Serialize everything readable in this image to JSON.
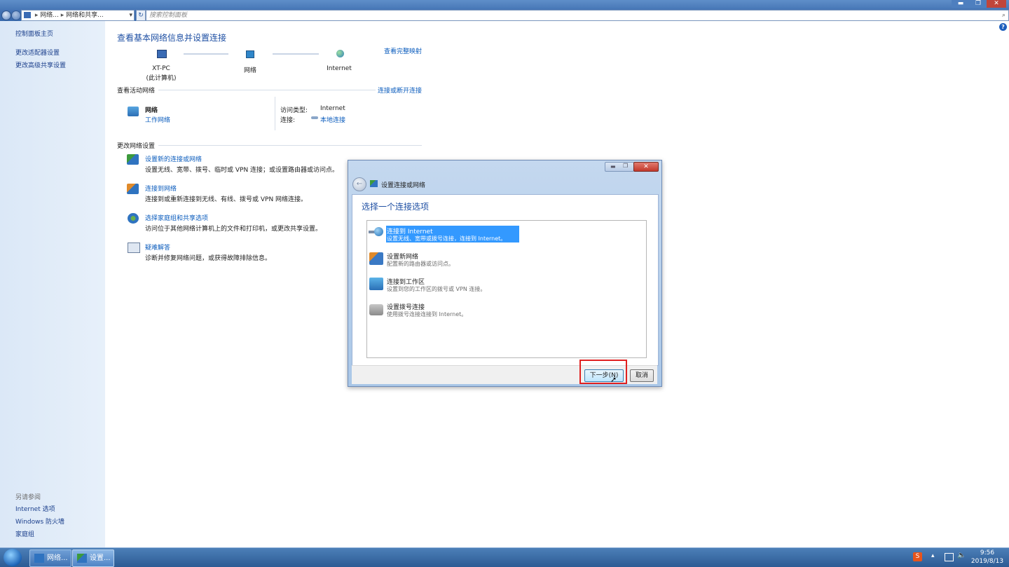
{
  "explorer": {
    "breadcrumb": [
      "网络...",
      "网络和共享..."
    ],
    "search_placeholder": "搜索控制面板",
    "window_buttons": [
      "▬",
      "❐",
      "✕"
    ],
    "help": "?"
  },
  "leftnav": {
    "home": "控制面板主页",
    "items": [
      "更改适配器设置",
      "更改高级共享设置"
    ],
    "see_also_label": "另请参阅",
    "see_also": [
      "Internet 选项",
      "Windows 防火墙",
      "家庭组"
    ]
  },
  "main": {
    "title": "查看基本网络信息并设置连接",
    "full_map_link": "查看完整映射",
    "nodes": [
      {
        "label": "XT-PC",
        "sub": "(此计算机)"
      },
      {
        "label": "网络",
        "sub": ""
      },
      {
        "label": "Internet",
        "sub": ""
      }
    ],
    "active_label": "查看活动网络",
    "connect_disconnect": "连接或断开连接",
    "network_name": "网络",
    "network_type": "工作网络",
    "access_type_label": "访问类型:",
    "access_type_value": "Internet",
    "connection_label": "连接:",
    "connection_value": "本地连接",
    "change_label": "更改网络设置",
    "tasks": [
      {
        "title": "设置新的连接或网络",
        "desc": "设置无线、宽带、拨号、临时或 VPN 连接；或设置路由器或访问点。",
        "icon": "network-setup-icon"
      },
      {
        "title": "连接到网络",
        "desc": "连接到或重新连接到无线、有线、拨号或 VPN 网络连接。",
        "icon": "connect-network-icon"
      },
      {
        "title": "选择家庭组和共享选项",
        "desc": "访问位于其他网络计算机上的文件和打印机，或更改共享设置。",
        "icon": "homegroup-icon"
      },
      {
        "title": "疑难解答",
        "desc": "诊断并修复网络问题，或获得故障排除信息。",
        "icon": "troubleshoot-icon"
      }
    ]
  },
  "dialog": {
    "window_title": "设置连接或网络",
    "heading": "选择一个连接选项",
    "options": [
      {
        "title": "连接到 Internet",
        "desc": "设置无线、宽带或拨号连接，连接到 Internet。",
        "icon": "globe-connect-icon",
        "selected": true
      },
      {
        "title": "设置新网络",
        "desc": "配置新的路由器或访问点。",
        "icon": "router-icon",
        "selected": false
      },
      {
        "title": "连接到工作区",
        "desc": "设置到您的工作区的拨号或 VPN 连接。",
        "icon": "workplace-icon",
        "selected": false
      },
      {
        "title": "设置拨号连接",
        "desc": "使用拨号连接连接到 Internet。",
        "icon": "dialup-phone-icon",
        "selected": false
      }
    ],
    "next_button": "下一步(N)",
    "cancel_button": "取消"
  },
  "taskbar": {
    "items": [
      "网络...",
      "设置..."
    ],
    "time": "9:56",
    "date": "2019/8/13"
  },
  "colors": {
    "accent": "#3399ff",
    "link": "#0b5cbd",
    "title": "#1e4fa3",
    "highlight_box": "#e02020"
  }
}
